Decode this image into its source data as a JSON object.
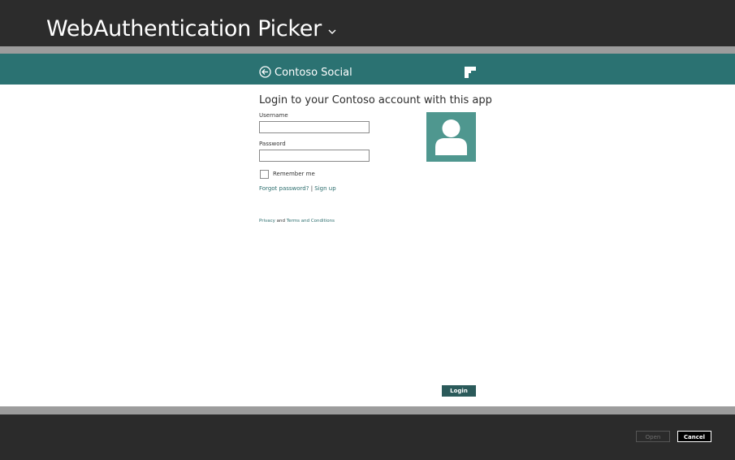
{
  "picker": {
    "title": "WebAuthentication Picker",
    "chevron_icon": "chevron-down-icon"
  },
  "app_header": {
    "back_icon": "back-arrow-circle-icon",
    "title": "Contoso Social",
    "logo_icon": "contoso-logo-icon",
    "color": "#2b7272"
  },
  "login": {
    "heading": "Login to your Contoso account with this app",
    "username_label": "Username",
    "username_value": "",
    "password_label": "Password",
    "password_value": "",
    "remember_label": "Remember me",
    "remember_checked": false,
    "forgot_link": "Forgot password?",
    "separator": "|",
    "signup_link": "Sign up",
    "privacy_link": "Privacy",
    "and_text": "and",
    "terms_link": "Terms and Conditions",
    "avatar_icon": "user-avatar-icon",
    "login_button": "Login"
  },
  "footer": {
    "open_button": "Open",
    "open_enabled": false,
    "cancel_button": "Cancel"
  }
}
